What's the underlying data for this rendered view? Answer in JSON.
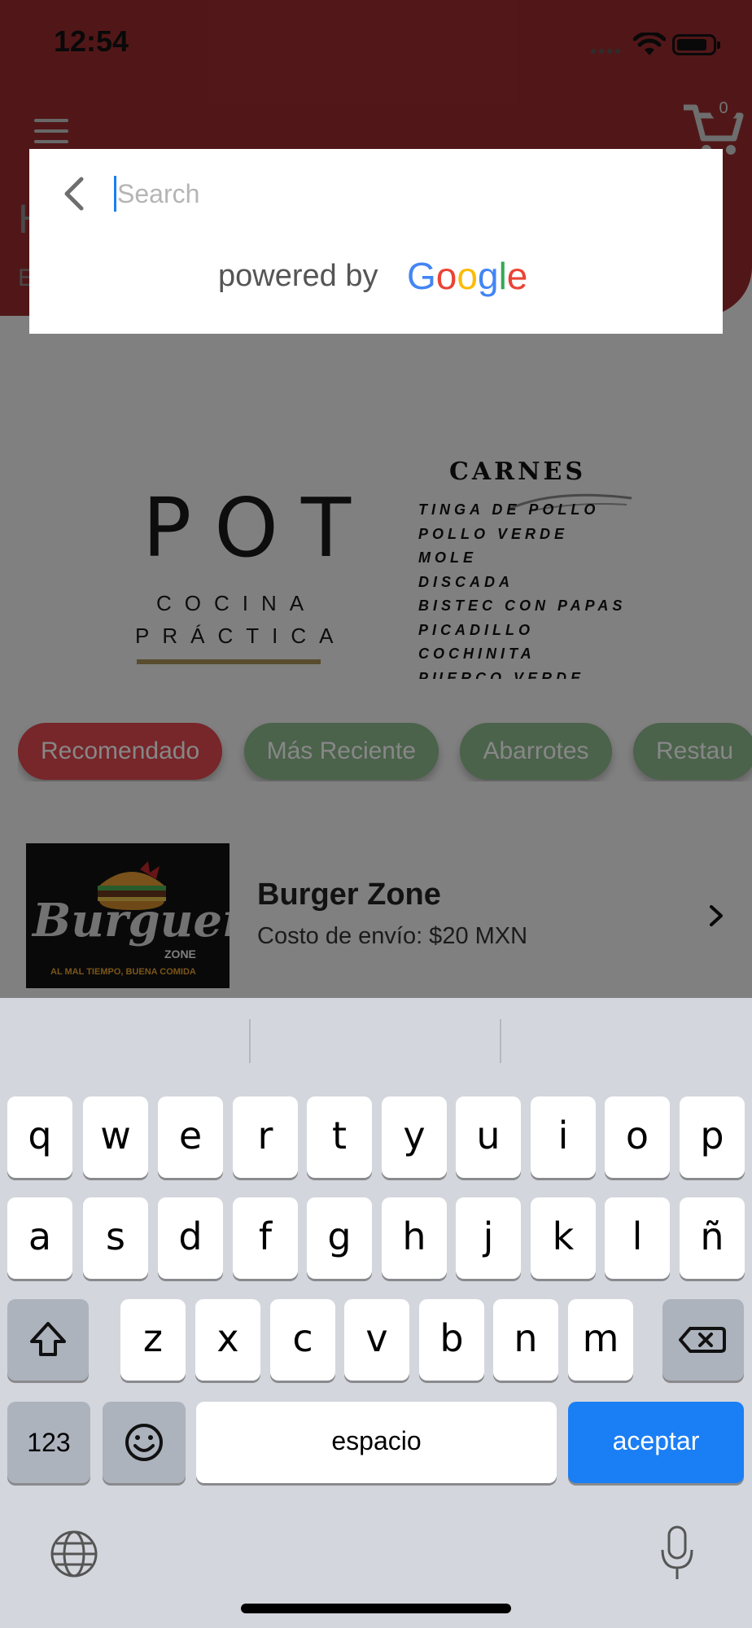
{
  "status_bar": {
    "time": "12:54"
  },
  "header": {
    "cart_count": "0",
    "title_initial": "H",
    "subtitle_initial": "E"
  },
  "banner": {
    "left": {
      "title": "POT",
      "line1": "COCINA",
      "line2": "PRÁCTICA"
    },
    "right": {
      "title": "CARNES",
      "items": [
        "TINGA DE POLLO",
        "POLLO VERDE",
        "MOLE",
        "DISCADA",
        "BISTEC CON PAPAS",
        "PICADILLO",
        "COCHINITA",
        "PUERCO VERDE"
      ]
    }
  },
  "categories": [
    {
      "label": "Recomendado",
      "selected": true
    },
    {
      "label": "Más Reciente",
      "selected": false
    },
    {
      "label": "Abarrotes",
      "selected": false
    },
    {
      "label": "Restau",
      "selected": false
    }
  ],
  "restaurant": {
    "name": "Burger Zone",
    "fee": "Costo de envío: $20 MXN",
    "logo_word": "Burguer",
    "logo_zone": "ZONE",
    "logo_tagline": "AL MAL TIEMPO, BUENA COMIDA"
  },
  "search": {
    "placeholder": "Search",
    "value": "",
    "powered_by": "powered by",
    "google_letters": [
      "G",
      "o",
      "o",
      "g",
      "l",
      "e"
    ]
  },
  "keyboard": {
    "row1": [
      "q",
      "w",
      "e",
      "r",
      "t",
      "y",
      "u",
      "i",
      "o",
      "p"
    ],
    "row2": [
      "a",
      "s",
      "d",
      "f",
      "g",
      "h",
      "j",
      "k",
      "l",
      "ñ"
    ],
    "row3": [
      "z",
      "x",
      "c",
      "v",
      "b",
      "n",
      "m"
    ],
    "numbers_label": "123",
    "space_label": "espacio",
    "return_label": "aceptar"
  },
  "colors": {
    "brand_red": "#9a2c2f",
    "chip_selected": "#e0484f",
    "chip_default": "#8fba8f",
    "keyboard_accent": "#1a7ef5"
  },
  "icons": [
    "hamburger-menu-icon",
    "cart-icon",
    "back-chevron-icon",
    "chevron-right-icon",
    "shift-icon",
    "delete-icon",
    "emoji-icon",
    "globe-icon",
    "microphone-icon",
    "wifi-icon",
    "battery-icon"
  ]
}
